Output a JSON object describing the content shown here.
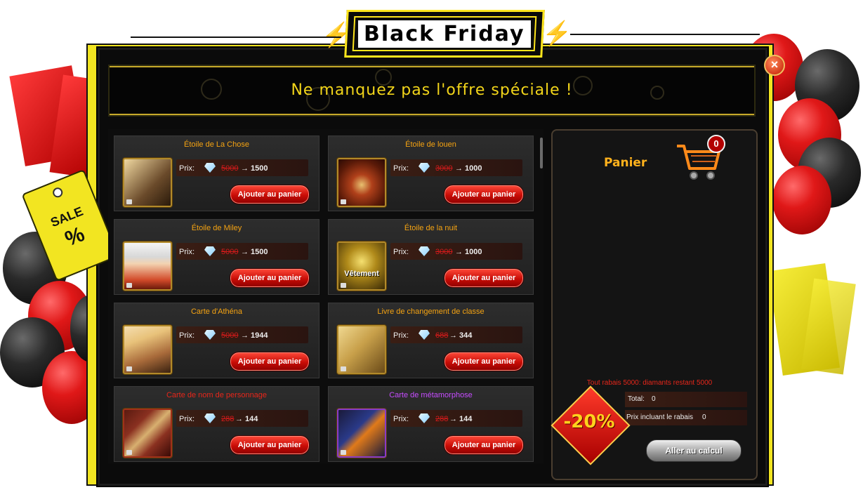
{
  "header": {
    "title": "Black Friday"
  },
  "banner": {
    "text": "Ne manquez pas l'offre spéciale !"
  },
  "sale_tag": {
    "line1": "SALE",
    "line2": "%"
  },
  "items": [
    {
      "title": "Étoile de La Chose",
      "prix_label": "Prix:",
      "old_price": "5000",
      "new_price": "1500",
      "button": "Ajouter au panier",
      "title_color": "orange"
    },
    {
      "title": "Étoile de louen",
      "prix_label": "Prix:",
      "old_price": "3000",
      "new_price": "1000",
      "button": "Ajouter au panier",
      "title_color": "orange"
    },
    {
      "title": "Étoile de Miley",
      "prix_label": "Prix:",
      "old_price": "5000",
      "new_price": "1500",
      "button": "Ajouter au panier",
      "title_color": "orange"
    },
    {
      "title": "Étoile de la nuit",
      "prix_label": "Prix:",
      "old_price": "3000",
      "new_price": "1000",
      "button": "Ajouter au panier",
      "title_color": "orange",
      "thumb_text": "Vêtement"
    },
    {
      "title": "Carte d'Athéna",
      "prix_label": "Prix:",
      "old_price": "5000",
      "new_price": "1944",
      "button": "Ajouter au panier",
      "title_color": "orange"
    },
    {
      "title": "Livre de changement de classe",
      "prix_label": "Prix:",
      "old_price": "688",
      "new_price": "344",
      "button": "Ajouter au panier",
      "title_color": "orange"
    },
    {
      "title": "Carte de nom de personnage",
      "prix_label": "Prix:",
      "old_price": "288",
      "new_price": "144",
      "button": "Ajouter au panier",
      "title_color": "red"
    },
    {
      "title": "Carte de métamorphose",
      "prix_label": "Prix:",
      "old_price": "288",
      "new_price": "144",
      "button": "Ajouter au panier",
      "title_color": "purple"
    }
  ],
  "cart": {
    "title": "Panier",
    "count": "0",
    "summary": "Tout rabais 5000: diamants restant 5000",
    "total_label": "Total:",
    "total_value": "0",
    "discount_label": "Prix incluant le rabais",
    "discount_value": "0",
    "discount_badge": "-20%",
    "calc_button": "Aller au calcul"
  },
  "colors": {
    "accent_yellow": "#f2e521",
    "title_orange": "#f5a312",
    "button_red": "#c80c06"
  },
  "icons": {
    "close": "close-icon",
    "cart": "shopping-cart-icon",
    "gem": "diamond-icon",
    "lock": "lock-icon"
  }
}
